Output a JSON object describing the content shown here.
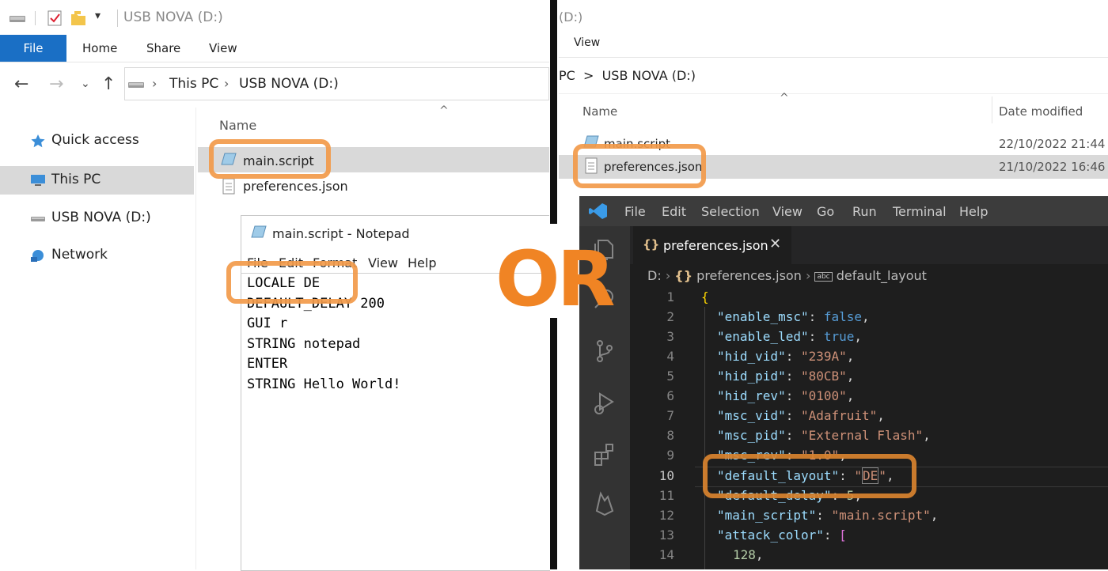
{
  "left_explorer": {
    "window_title": "USB NOVA (D:)",
    "ribbon_tabs": {
      "file": "File",
      "home": "Home",
      "share": "Share",
      "view": "View"
    },
    "address": {
      "this_pc": "This PC",
      "sep": ">",
      "drive": "USB NOVA (D:)"
    },
    "sidebar": {
      "quick_access": "Quick access",
      "this_pc": "This PC",
      "usb": "USB NOVA (D:)",
      "network": "Network"
    },
    "columns": {
      "name": "Name"
    },
    "files": [
      "main.script",
      "preferences.json"
    ]
  },
  "notepad": {
    "title": "main.script - Notepad",
    "menu": {
      "file": "File",
      "edit": "Edit",
      "format": "Format",
      "view": "View",
      "help": "Help"
    },
    "lines": [
      "LOCALE DE",
      "DEFAULT_DELAY 200",
      "GUI r",
      "STRING notepad",
      "ENTER",
      "STRING Hello World!"
    ]
  },
  "or_label": "OR",
  "right_explorer": {
    "window_title": "(D:)",
    "ribbon_view": "View",
    "address": "PC  >  USB NOVA (D:)",
    "columns": {
      "name": "Name",
      "date": "Date modified"
    },
    "files": [
      {
        "name": "main.script",
        "date": "22/10/2022 21:44"
      },
      {
        "name": "preferences.json",
        "date": "21/10/2022 16:46"
      }
    ]
  },
  "vscode": {
    "menu": {
      "file": "File",
      "edit": "Edit",
      "selection": "Selection",
      "view": "View",
      "go": "Go",
      "run": "Run",
      "terminal": "Terminal",
      "help": "Help"
    },
    "tab": {
      "name": "preferences.json",
      "close": "✕"
    },
    "breadcrumb": {
      "drive": "D:",
      "file": "preferences.json",
      "key": "default_layout"
    },
    "line_numbers": [
      "1",
      "2",
      "3",
      "4",
      "5",
      "6",
      "7",
      "8",
      "9",
      "10",
      "11",
      "12",
      "13",
      "14"
    ],
    "code": {
      "l1": "{",
      "k2": "\"enable_msc\"",
      "v2": "false",
      "k3": "\"enable_led\"",
      "v3": "true",
      "k4": "\"hid_vid\"",
      "v4": "\"239A\"",
      "k5": "\"hid_pid\"",
      "v5": "\"80CB\"",
      "k6": "\"hid_rev\"",
      "v6": "\"0100\"",
      "k7": "\"msc_vid\"",
      "v7": "\"Adafruit\"",
      "k8": "\"msc_pid\"",
      "v8": "\"External Flash\"",
      "k9": "\"msc_rev\"",
      "v9": "\"1.0\"",
      "k10": "\"default_layout\"",
      "v10a": "\"",
      "v10b": "DE",
      "v10c": "\"",
      "k11": "\"default_delay\"",
      "v11": "5",
      "k12": "\"main_script\"",
      "v12": "\"main.script\"",
      "k13": "\"attack_color\"",
      "v13": "[",
      "v14": "128"
    }
  }
}
